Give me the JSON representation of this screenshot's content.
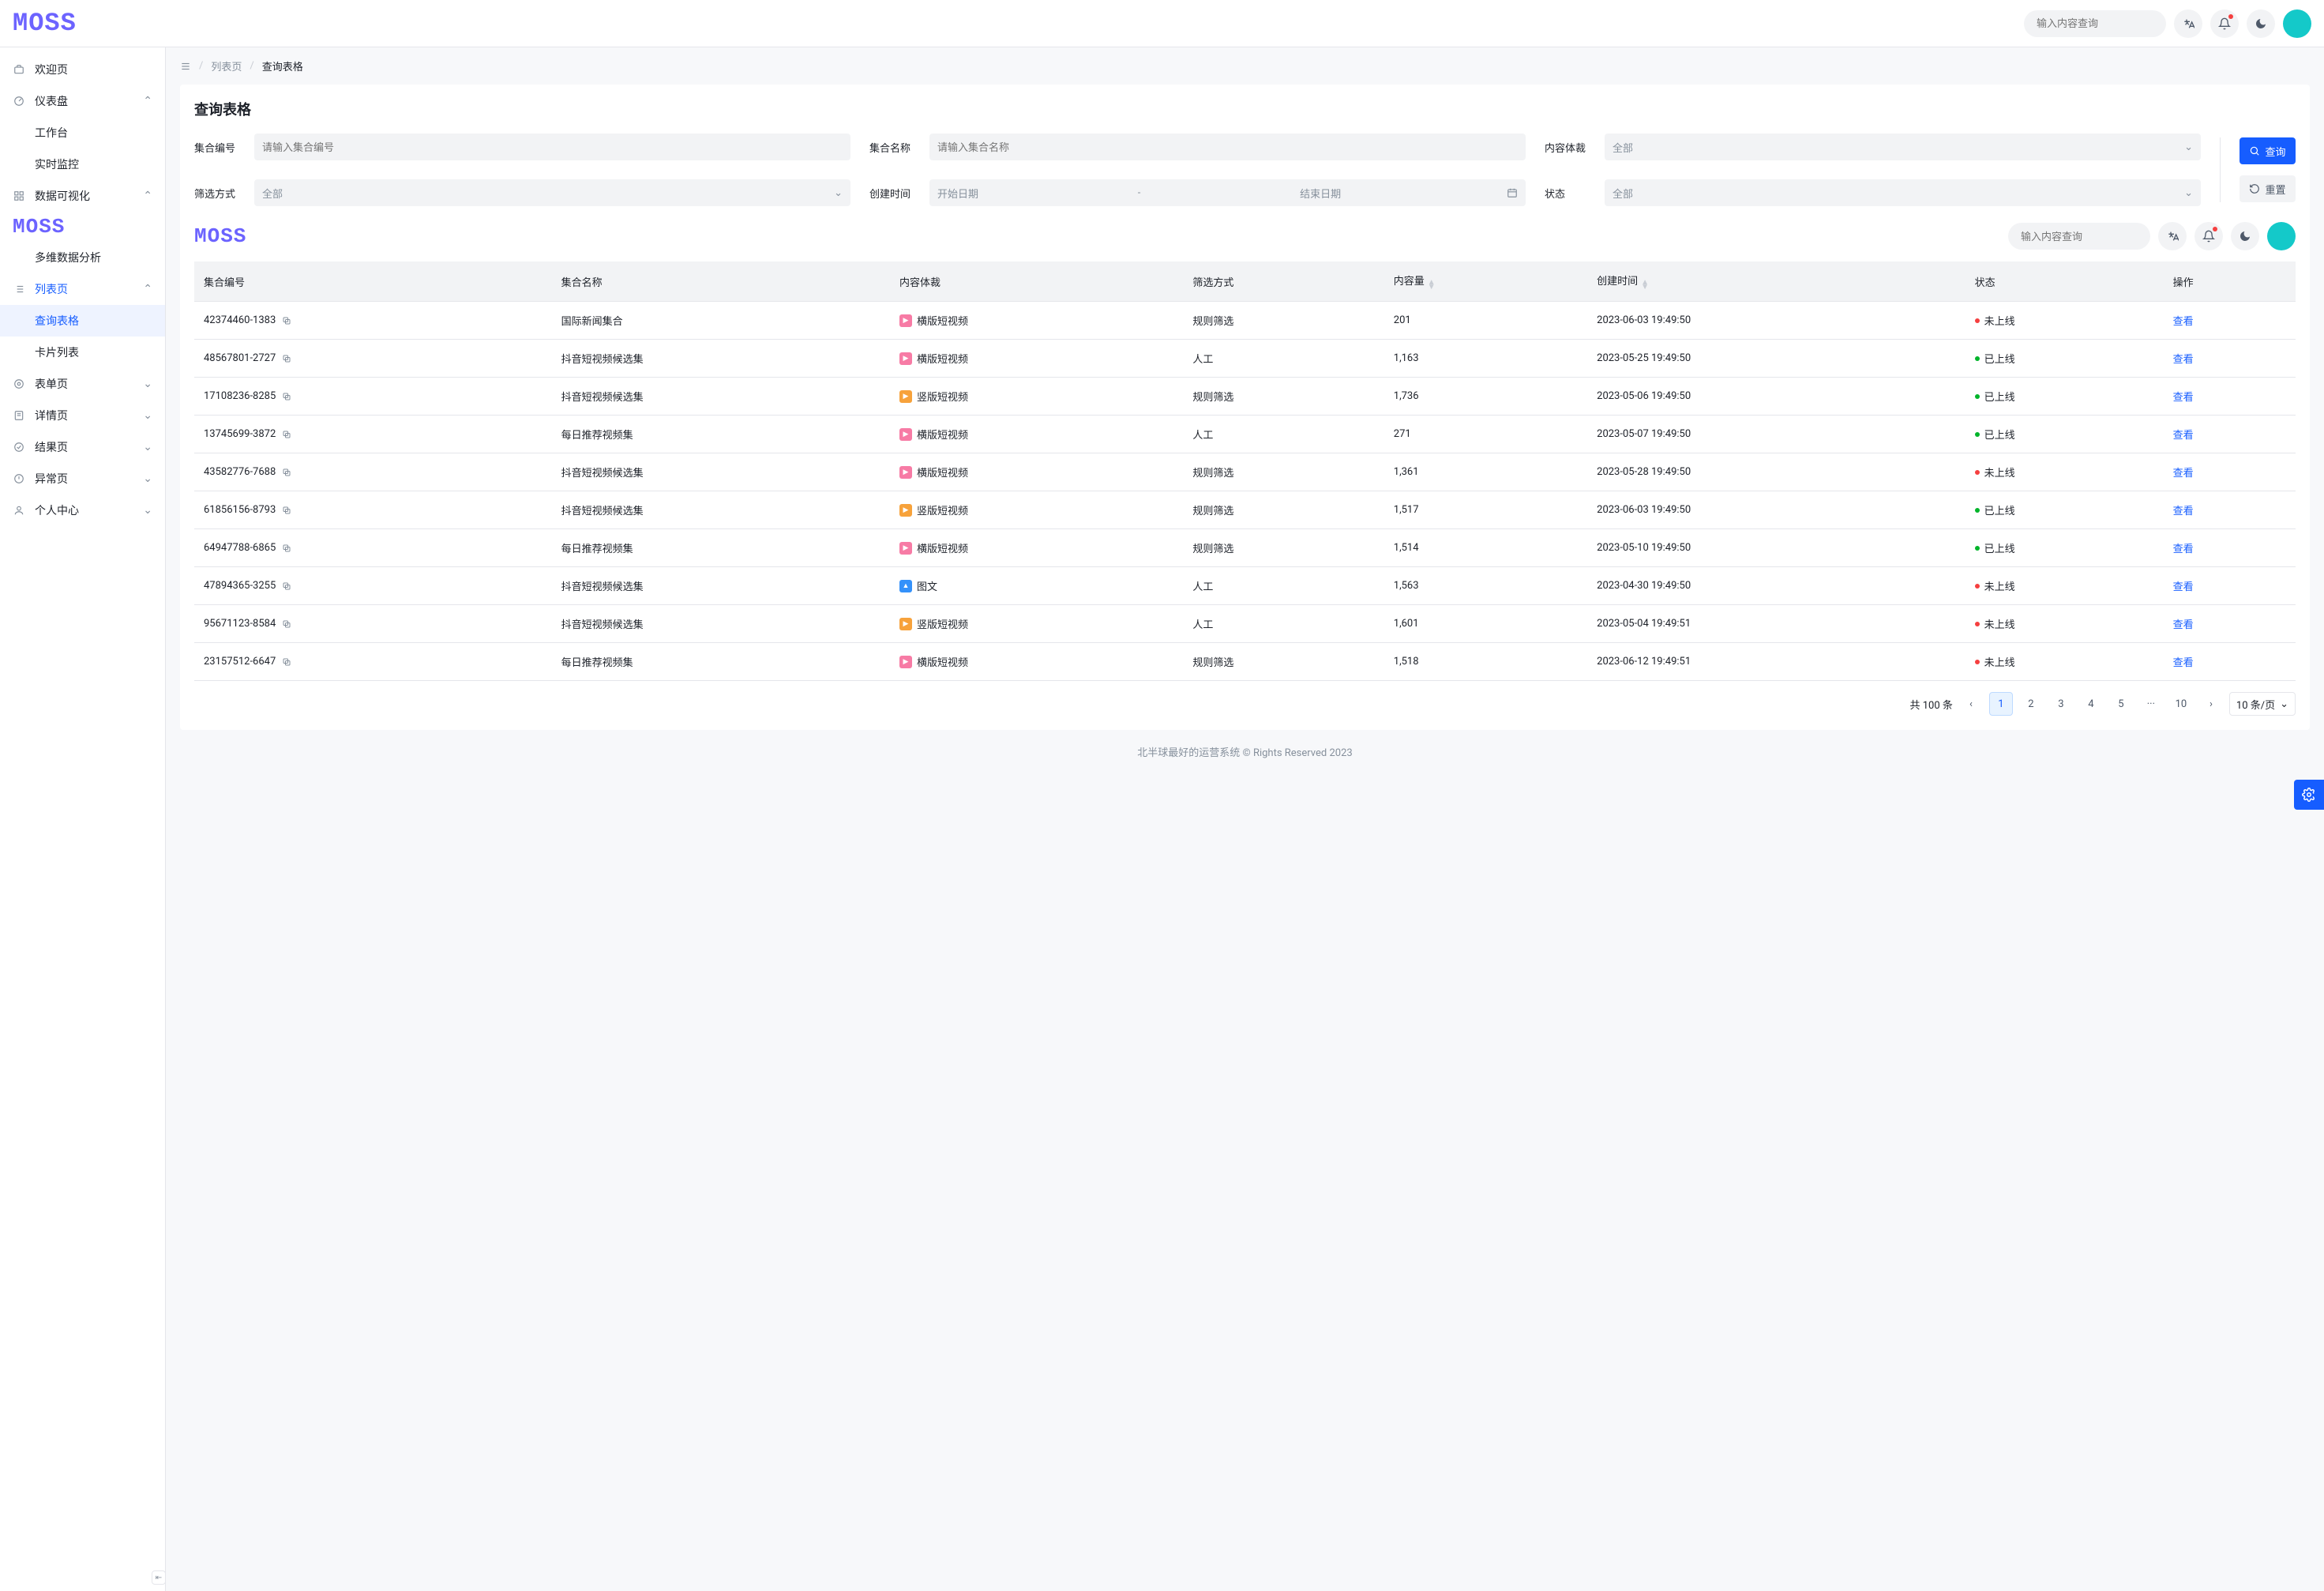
{
  "header": {
    "search_placeholder": "输入内容查询",
    "lang_icon": "translate-icon",
    "notif_icon": "bell-icon",
    "theme_icon": "moon-icon"
  },
  "logo_text": "MOSS",
  "sidebar": {
    "items": [
      {
        "icon": "home-icon",
        "label": "欢迎页",
        "chev": null
      },
      {
        "icon": "dashboard-icon",
        "label": "仪表盘",
        "chev": "up"
      },
      {
        "icon": null,
        "label": "工作台",
        "child": true
      },
      {
        "icon": null,
        "label": "实时监控",
        "child": true
      },
      {
        "icon": "grid-icon",
        "label": "数据可视化",
        "chev": "up"
      },
      {
        "icon": null,
        "label": "多维数据分析",
        "child": true
      },
      {
        "icon": "list-icon",
        "label": "列表页",
        "chev": "up",
        "active_group": true
      },
      {
        "icon": null,
        "label": "查询表格",
        "child": true,
        "active": true
      },
      {
        "icon": null,
        "label": "卡片列表",
        "child": true
      },
      {
        "icon": "form-icon",
        "label": "表单页",
        "chev": "down"
      },
      {
        "icon": "detail-icon",
        "label": "详情页",
        "chev": "down"
      },
      {
        "icon": "result-icon",
        "label": "结果页",
        "chev": "down"
      },
      {
        "icon": "warning-icon",
        "label": "异常页",
        "chev": "down"
      },
      {
        "icon": "user-icon",
        "label": "个人中心",
        "chev": "down"
      }
    ]
  },
  "breadcrumb": {
    "items": [
      "列表页",
      "查询表格"
    ]
  },
  "panel": {
    "title": "查询表格",
    "form": {
      "id_label": "集合编号",
      "id_placeholder": "请输入集合编号",
      "name_label": "集合名称",
      "name_placeholder": "请输入集合名称",
      "type_label": "内容体裁",
      "type_value": "全部",
      "filter_label": "筛选方式",
      "filter_value": "全部",
      "created_label": "创建时间",
      "date_start_placeholder": "开始日期",
      "date_end_placeholder": "结束日期",
      "status_label": "状态",
      "status_value": "全部",
      "query_btn": "查询",
      "reset_btn": "重置"
    },
    "columns": {
      "id": "集合编号",
      "name": "集合名称",
      "type": "内容体裁",
      "filter": "筛选方式",
      "count": "内容量",
      "created": "创建时间",
      "status": "状态",
      "op": "操作"
    },
    "op_link": "查看",
    "rows": [
      {
        "id": "42374460-1383",
        "name": "国际新闻集合",
        "type": "横版短视频",
        "type_color": "pink",
        "filter": "规则筛选",
        "count": "201",
        "created": "2023-06-03 19:49:50",
        "status": "未上线",
        "status_color": "red"
      },
      {
        "id": "48567801-2727",
        "name": "抖音短视频候选集",
        "type": "横版短视频",
        "type_color": "pink",
        "filter": "人工",
        "count": "1,163",
        "created": "2023-05-25 19:49:50",
        "status": "已上线",
        "status_color": "green"
      },
      {
        "id": "17108236-8285",
        "name": "抖音短视频候选集",
        "type": "竖版短视频",
        "type_color": "orange",
        "filter": "规则筛选",
        "count": "1,736",
        "created": "2023-05-06 19:49:50",
        "status": "已上线",
        "status_color": "green"
      },
      {
        "id": "13745699-3872",
        "name": "每日推荐视频集",
        "type": "横版短视频",
        "type_color": "pink",
        "filter": "人工",
        "count": "271",
        "created": "2023-05-07 19:49:50",
        "status": "已上线",
        "status_color": "green"
      },
      {
        "id": "43582776-7688",
        "name": "抖音短视频候选集",
        "type": "横版短视频",
        "type_color": "pink",
        "filter": "规则筛选",
        "count": "1,361",
        "created": "2023-05-28 19:49:50",
        "status": "未上线",
        "status_color": "red"
      },
      {
        "id": "61856156-8793",
        "name": "抖音短视频候选集",
        "type": "竖版短视频",
        "type_color": "orange",
        "filter": "规则筛选",
        "count": "1,517",
        "created": "2023-06-03 19:49:50",
        "status": "已上线",
        "status_color": "green"
      },
      {
        "id": "64947788-6865",
        "name": "每日推荐视频集",
        "type": "横版短视频",
        "type_color": "pink",
        "filter": "规则筛选",
        "count": "1,514",
        "created": "2023-05-10 19:49:50",
        "status": "已上线",
        "status_color": "green"
      },
      {
        "id": "47894365-3255",
        "name": "抖音短视频候选集",
        "type": "图文",
        "type_color": "blue",
        "filter": "人工",
        "count": "1,563",
        "created": "2023-04-30 19:49:50",
        "status": "未上线",
        "status_color": "red"
      },
      {
        "id": "95671123-8584",
        "name": "抖音短视频候选集",
        "type": "竖版短视频",
        "type_color": "orange",
        "filter": "人工",
        "count": "1,601",
        "created": "2023-05-04 19:49:51",
        "status": "未上线",
        "status_color": "red"
      },
      {
        "id": "23157512-6647",
        "name": "每日推荐视频集",
        "type": "横版短视频",
        "type_color": "pink",
        "filter": "规则筛选",
        "count": "1,518",
        "created": "2023-06-12 19:49:51",
        "status": "未上线",
        "status_color": "red"
      }
    ],
    "pagination": {
      "total_text": "共 100 条",
      "pages": [
        "1",
        "2",
        "3",
        "4",
        "5",
        "···",
        "10"
      ],
      "current": "1",
      "size_text": "10 条/页"
    }
  },
  "footer": "北半球最好的运营系统 © Rights Reserved 2023"
}
